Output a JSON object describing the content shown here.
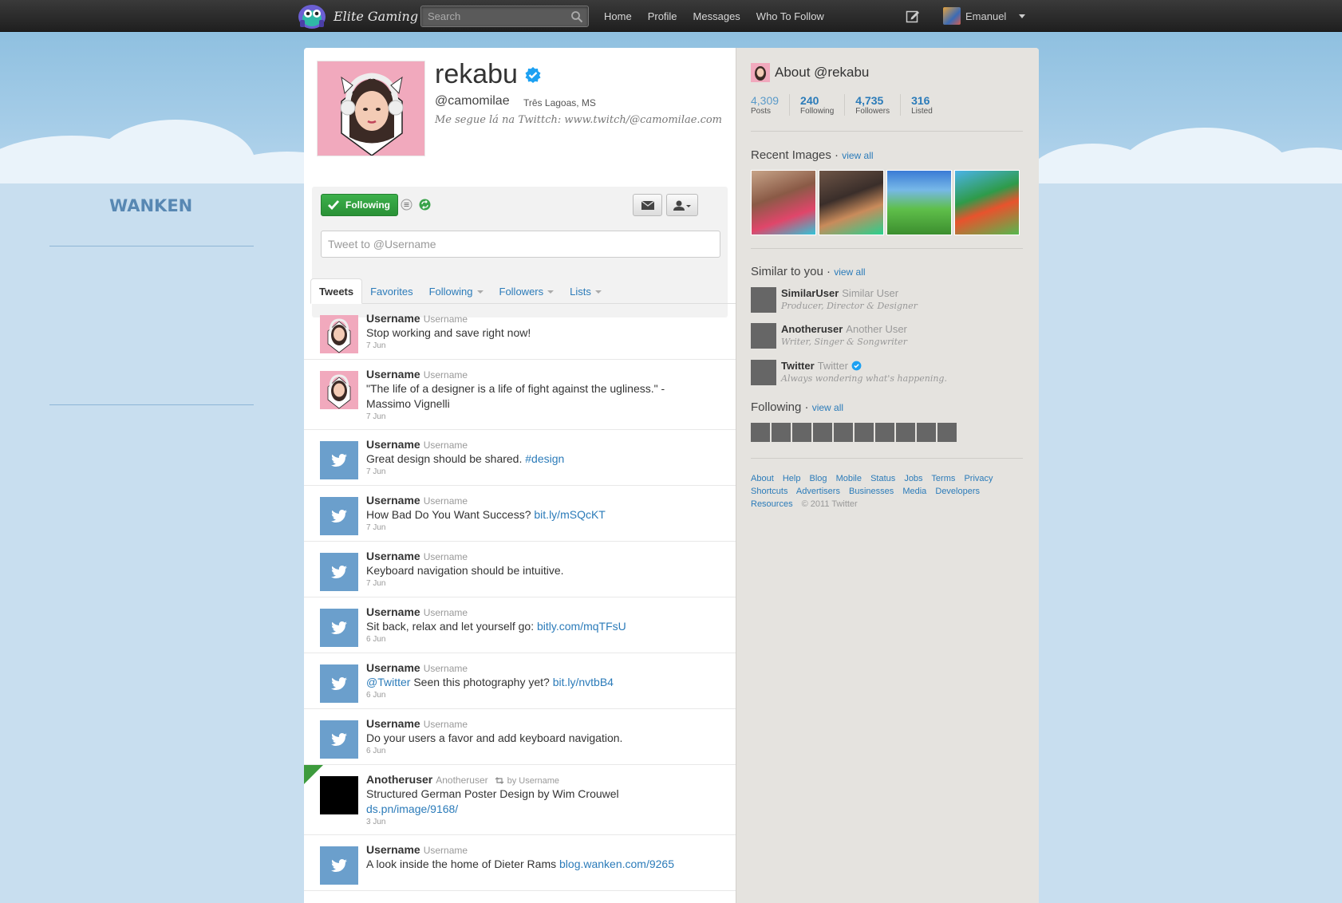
{
  "topbar": {
    "brand": "Elite Gaming",
    "search_placeholder": "Search",
    "nav": [
      "Home",
      "Profile",
      "Messages",
      "Who To Follow"
    ],
    "user_name": "Emanuel"
  },
  "sidebar": {
    "brand": "WANKEN"
  },
  "profile": {
    "name": "rekabu",
    "handle": "@camomilae",
    "location": "Três Lagoas, MS",
    "bio": "Me segue lá na Twittch: www.twitch/@camomilae.com",
    "following_label": "Following",
    "tweet_placeholder": "Tweet to @Username"
  },
  "tabs": [
    "Tweets",
    "Favorites",
    "Following",
    "Followers",
    "Lists"
  ],
  "tweets": [
    {
      "user": "Username",
      "handle": "Username",
      "text": "Stop working and save right now!",
      "link": "",
      "date": "7 Jun",
      "avatar": "pic"
    },
    {
      "user": "Username",
      "handle": "Username",
      "text": "\"The life of a designer is a life of fight against the ugliness.\" - Massimo Vignelli",
      "link": "",
      "date": "7 Jun",
      "avatar": "pic"
    },
    {
      "user": "Username",
      "handle": "Username",
      "text": "Great design should be shared.",
      "link": "#design",
      "date": "7 Jun",
      "avatar": "bird"
    },
    {
      "user": "Username",
      "handle": "Username",
      "text": "How Bad Do You Want Success?",
      "link": "bit.ly/mSQcKT",
      "date": "7 Jun",
      "avatar": "bird"
    },
    {
      "user": "Username",
      "handle": "Username",
      "text": "Keyboard navigation should be intuitive.",
      "link": "",
      "date": "7 Jun",
      "avatar": "bird"
    },
    {
      "user": "Username",
      "handle": "Username",
      "text": "Sit back, relax and let yourself go:",
      "link": "bitly.com/mqTFsU",
      "date": "6 Jun",
      "avatar": "bird"
    },
    {
      "user": "Username",
      "handle": "Username",
      "pre_link": "@Twitter",
      "text": "Seen this photography yet?",
      "link": "bit.ly/nvtbB4",
      "date": "6 Jun",
      "avatar": "bird"
    },
    {
      "user": "Username",
      "handle": "Username",
      "text": "Do your users a favor and add keyboard navigation.",
      "link": "",
      "date": "6 Jun",
      "avatar": "bird"
    },
    {
      "user": "Anotheruser",
      "handle": "Anotheruser",
      "retweet": "by Username",
      "text": "Structured German Poster Design by Wim Crouwel",
      "link": "ds.pn/image/9168/",
      "date": "3 Jun",
      "avatar": "black"
    },
    {
      "user": "Username",
      "handle": "Username",
      "text": "A look inside the home of Dieter Rams",
      "link": "blog.wanken.com/9265",
      "date": "",
      "avatar": "bird"
    }
  ],
  "about": {
    "title": "About @rekabu",
    "stats": [
      {
        "num": "4,309",
        "label": "Posts"
      },
      {
        "num": "240",
        "label": "Following"
      },
      {
        "num": "4,735",
        "label": "Followers"
      },
      {
        "num": "316",
        "label": "Listed"
      }
    ],
    "recent_images_title": "Recent Images ·",
    "view_all": "view all",
    "similar_title": "Similar to you ·",
    "similar": [
      {
        "name": "SimilarUser",
        "handle": "Similar User",
        "bio": "Producer, Director & Designer",
        "verified": false
      },
      {
        "name": "Anotheruser",
        "handle": "Another User",
        "bio": "Writer, Singer & Songwriter",
        "verified": false
      },
      {
        "name": "Twitter",
        "handle": "Twitter",
        "bio": "Always wondering what's happening.",
        "verified": true
      }
    ],
    "following_title": "Following ·",
    "following_count_shown": 10,
    "footer_links": [
      "About",
      "Help",
      "Blog",
      "Mobile",
      "Status",
      "Jobs",
      "Terms",
      "Privacy",
      "Shortcuts",
      "Advertisers",
      "Businesses",
      "Media",
      "Developers",
      "Resources"
    ],
    "copyright": "© 2011 Twitter"
  },
  "colors": {
    "link": "#2b7bb9",
    "following_green": "#2a9136",
    "verified": "#1da1f2",
    "bird_avatar": "#6b9fcc"
  }
}
